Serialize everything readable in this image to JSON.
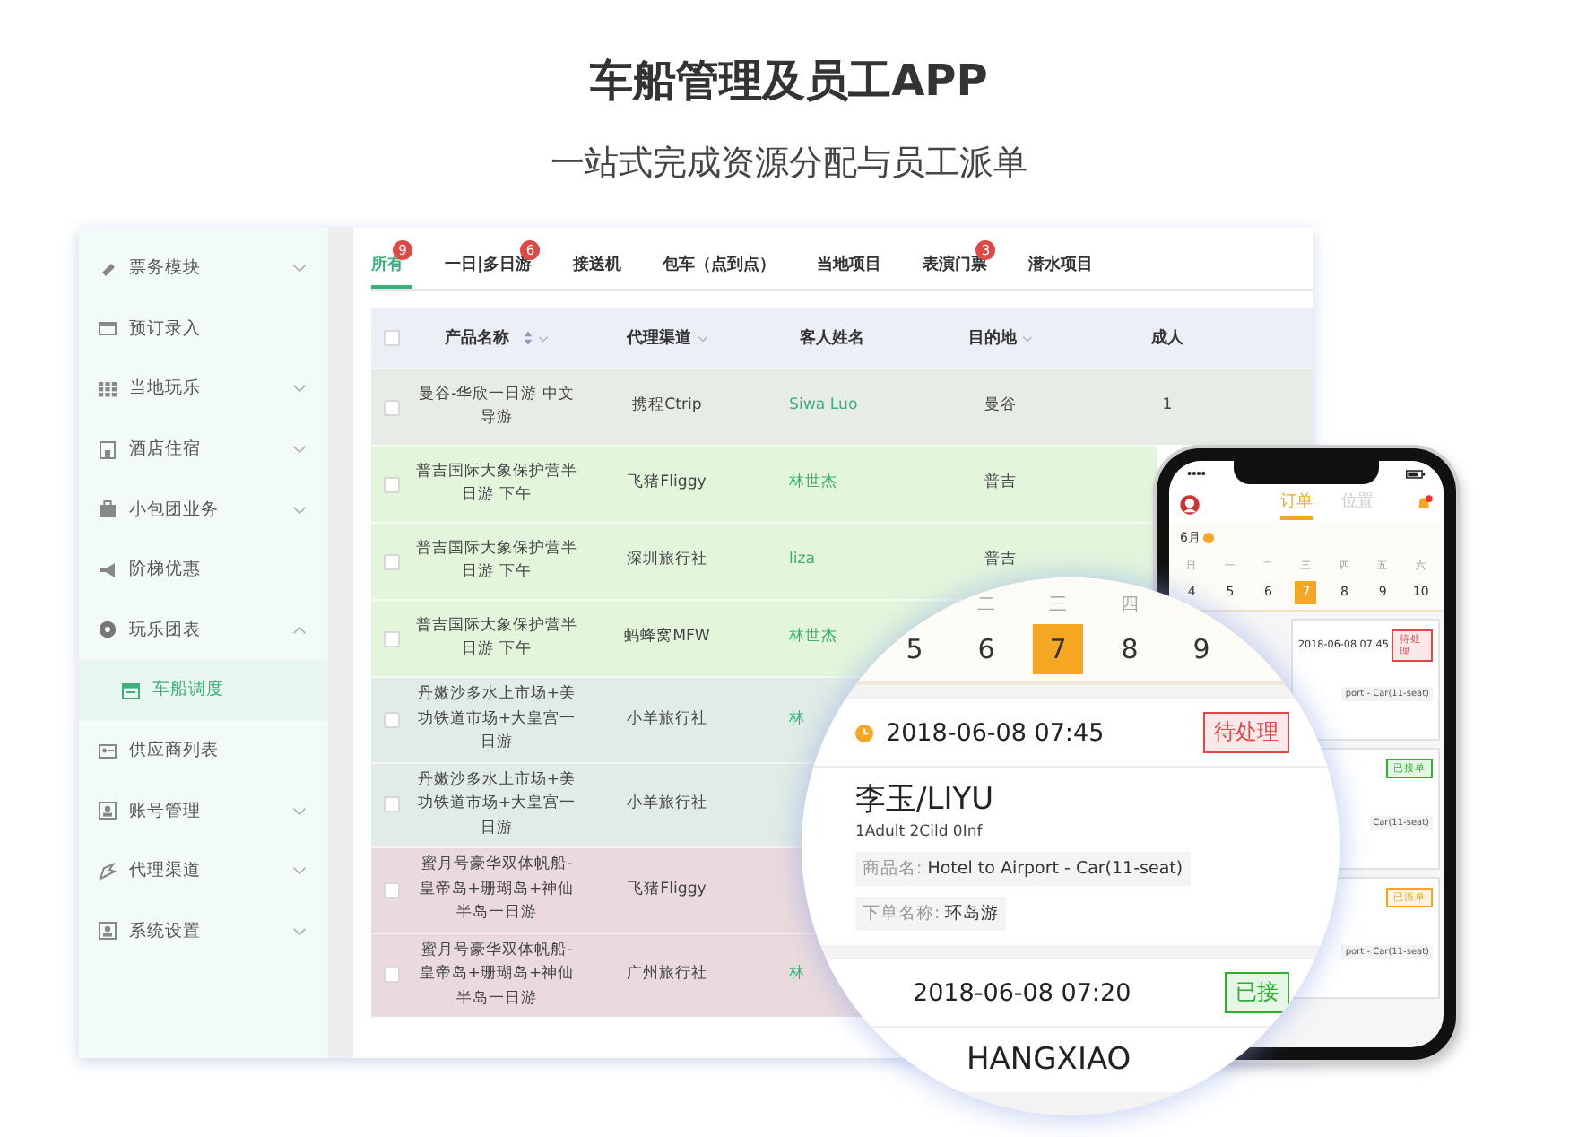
{
  "header": {
    "title": "车船管理及员工APP",
    "subtitle": "一站式完成资源分配与员工派单"
  },
  "sidebar": {
    "items": [
      {
        "label": "票务模块",
        "kind": "group",
        "expanded": false,
        "selected": false
      },
      {
        "label": "预订录入",
        "kind": "link",
        "selected": false
      },
      {
        "label": "当地玩乐",
        "kind": "group",
        "expanded": false,
        "selected": false
      },
      {
        "label": "酒店住宿",
        "kind": "group",
        "expanded": false,
        "selected": false
      },
      {
        "label": "小包团业务",
        "kind": "group",
        "expanded": false,
        "selected": false
      },
      {
        "label": "阶梯优惠",
        "kind": "link",
        "selected": false
      },
      {
        "label": "玩乐团表",
        "kind": "group",
        "expanded": true,
        "selected": false,
        "children": [
          {
            "label": "车船调度",
            "selected": true
          }
        ]
      },
      {
        "label": "供应商列表",
        "kind": "link",
        "selected": false
      },
      {
        "label": "账号管理",
        "kind": "group",
        "expanded": false,
        "selected": false
      },
      {
        "label": "代理渠道",
        "kind": "group",
        "expanded": false,
        "selected": false
      },
      {
        "label": "系统设置",
        "kind": "group",
        "expanded": false,
        "selected": false
      }
    ]
  },
  "tabs": [
    {
      "label": "所有",
      "badge": "9",
      "selected": true
    },
    {
      "label": "一日|多日游",
      "badge": "6",
      "selected": false
    },
    {
      "label": "接送机",
      "selected": false
    },
    {
      "label": "包车（点到点）",
      "selected": false
    },
    {
      "label": "当地项目",
      "selected": false
    },
    {
      "label": "表演门票",
      "badge": "3",
      "selected": false
    },
    {
      "label": "潜水项目",
      "selected": false
    }
  ],
  "table": {
    "header_checked": false,
    "columns": [
      {
        "label": "产品名称",
        "sortable": true,
        "filter": true
      },
      {
        "label": "代理渠道",
        "sortable": false,
        "filter": true
      },
      {
        "label": "客人姓名",
        "sortable": false,
        "filter": false
      },
      {
        "label": "目的地",
        "sortable": false,
        "filter": true
      },
      {
        "label": "成人",
        "sortable": false,
        "filter": false
      }
    ],
    "rows": [
      {
        "color": "#e8ece6",
        "checked": false,
        "cells": [
          "曼谷-华欣一日游 中文导游",
          "携程Ctrip",
          "Siwa Luo",
          "曼谷",
          "1"
        ]
      },
      {
        "color": "#e3f6dc",
        "checked": false,
        "cells": [
          "普吉国际大象保护营半日游 下午",
          "飞猪Fliggy",
          "林世杰",
          "普吉",
          null
        ]
      },
      {
        "color": "#e3f6dc",
        "checked": false,
        "cells": [
          "普吉国际大象保护营半日游 下午",
          "深圳旅行社",
          "liza",
          "普吉",
          null
        ]
      },
      {
        "color": "#e3f6dc",
        "checked": false,
        "cells": [
          "普吉国际大象保护营半日游 下午",
          "蚂蜂窝MFW",
          "林世杰",
          null,
          null
        ]
      },
      {
        "color": "#e1ece6",
        "checked": false,
        "cells": [
          "丹嫩沙多水上市场+美功铁道市场+大皇宫一日游",
          "小羊旅行社",
          "林",
          null,
          null
        ]
      },
      {
        "color": "#e1ece6",
        "checked": false,
        "cells": [
          "丹嫩沙多水上市场+美功铁道市场+大皇宫一日游",
          "小羊旅行社",
          null,
          null,
          null
        ]
      },
      {
        "color": "#ebdadd",
        "checked": false,
        "cells": [
          "蜜月号豪华双体帆船-皇帝岛+珊瑚岛+神仙半岛一日游",
          "飞猪Fliggy",
          null,
          null,
          null
        ]
      },
      {
        "color": "#ebdadd",
        "checked": false,
        "cells": [
          "蜜月号豪华双体帆船-皇帝岛+珊瑚岛+神仙半岛一日游",
          "广州旅行社",
          "林",
          null,
          null
        ]
      }
    ]
  },
  "phone": {
    "tabs": [
      {
        "label": "订单",
        "selected": true
      },
      {
        "label": "位置",
        "selected": false
      }
    ],
    "month": "6月",
    "weekdays": [
      "日",
      "一",
      "二",
      "三",
      "四",
      "五",
      "六"
    ],
    "dates": [
      {
        "label": "4",
        "selected": false
      },
      {
        "label": "5",
        "selected": false
      },
      {
        "label": "6",
        "selected": false
      },
      {
        "label": "7",
        "selected": true
      },
      {
        "label": "8",
        "selected": false
      },
      {
        "label": "9",
        "selected": false
      },
      {
        "label": "10",
        "selected": false
      }
    ],
    "orders": [
      {
        "time": "2018-06-08 07:45",
        "status": "待处理",
        "color": "#e04848",
        "product": "port - Car(11-seat)"
      },
      {
        "status": "已接单",
        "color": "#2fb12f",
        "product": "Car(11-seat)"
      },
      {
        "status": "已派单",
        "color": "#f5a623",
        "product": "port - Car(11-seat)"
      }
    ]
  },
  "magnifier": {
    "weekdays": [
      "二",
      "三",
      "四"
    ],
    "dates": [
      {
        "label": "5",
        "selected": false
      },
      {
        "label": "6",
        "selected": false
      },
      {
        "label": "7",
        "selected": true
      },
      {
        "label": "8",
        "selected": false
      },
      {
        "label": "9",
        "selected": false
      }
    ],
    "orders": [
      {
        "time": "2018-06-08 07:45",
        "status": "待处理",
        "color": "#e04848",
        "name": "李玉/LIYU",
        "pax": "1Adult  2Cild  0Inf",
        "product_label": "商品名:",
        "product": "Hotel to Airport - Car(11-seat)",
        "order_label": "下单名称:",
        "order_name": "环岛游"
      },
      {
        "time": "2018-06-08 07:20",
        "status": "已接",
        "color": "#2fb12f",
        "name": "HANGXIAO"
      }
    ]
  }
}
